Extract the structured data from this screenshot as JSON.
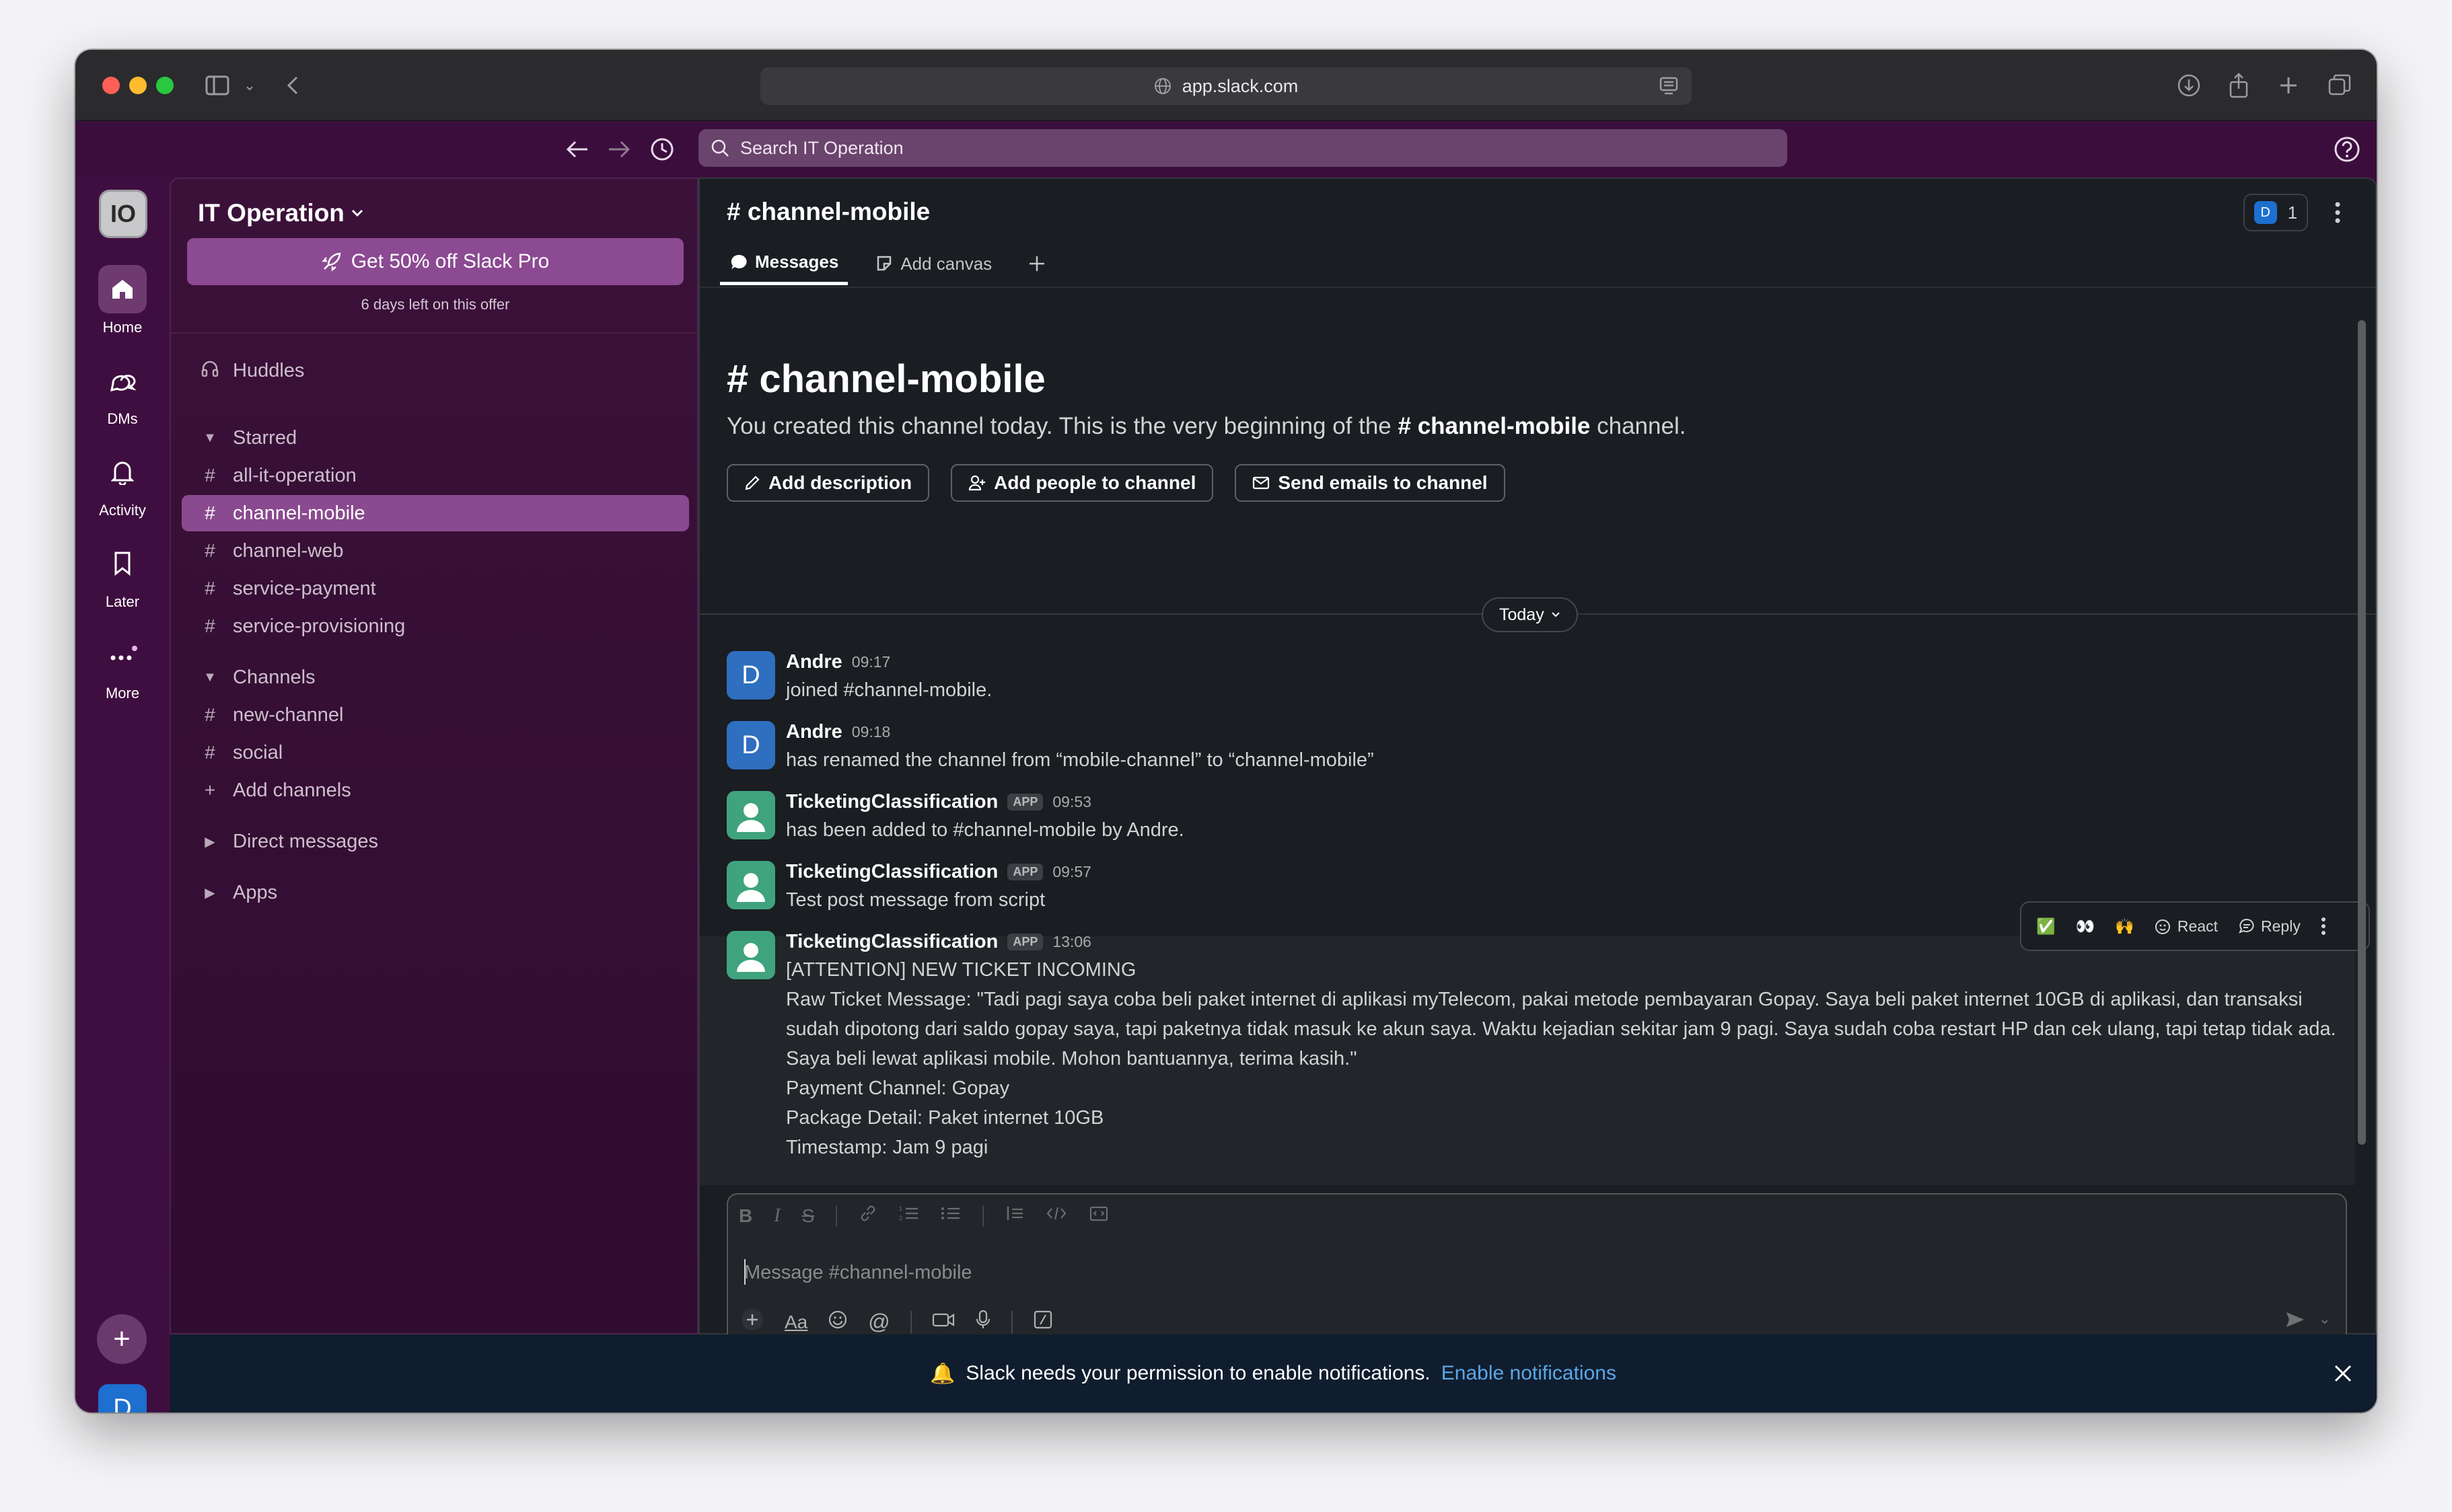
{
  "browser": {
    "url": "app.slack.com"
  },
  "topbar": {
    "search_placeholder": "Search IT Operation"
  },
  "rail": {
    "workspace_initials": "IO",
    "items": [
      {
        "label": "Home"
      },
      {
        "label": "DMs"
      },
      {
        "label": "Activity"
      },
      {
        "label": "Later"
      },
      {
        "label": "More"
      }
    ],
    "user_initial": "D"
  },
  "sidebar": {
    "workspace_name": "IT Operation",
    "promo_label": "Get 50% off Slack Pro",
    "promo_sub": "6 days left on this offer",
    "huddles": "Huddles",
    "starred_header": "Starred",
    "starred": [
      "all-it-operation",
      "channel-mobile",
      "channel-web",
      "service-payment",
      "service-provisioning"
    ],
    "channels_header": "Channels",
    "channels": [
      "new-channel",
      "social"
    ],
    "add_channels": "Add channels",
    "dm_header": "Direct messages",
    "apps_header": "Apps"
  },
  "channel": {
    "title": "# channel-mobile",
    "member_initial": "D",
    "member_count": "1",
    "tabs": [
      {
        "label": "Messages"
      },
      {
        "label": "Add canvas"
      }
    ],
    "intro_title": "# channel-mobile",
    "intro_pre": "You created this channel today. This is the very beginning of the ",
    "intro_channel": "# channel-mobile",
    "intro_post": " channel.",
    "buttons": [
      "Add description",
      "Add people to channel",
      "Send emails to channel"
    ],
    "day_divider": "Today"
  },
  "messages": [
    {
      "sender": "Andre",
      "time": "09:17",
      "avatar": "D",
      "app": false,
      "lines": [
        "joined #channel-mobile."
      ]
    },
    {
      "sender": "Andre",
      "time": "09:18",
      "avatar": "D",
      "app": false,
      "lines": [
        "has renamed the channel from “mobile-channel” to “channel-mobile”"
      ]
    },
    {
      "sender": "TicketingClassification",
      "time": "09:53",
      "app": true,
      "app_tag": "APP",
      "lines": [
        "has been added to #channel-mobile by Andre."
      ]
    },
    {
      "sender": "TicketingClassification",
      "time": "09:57",
      "app": true,
      "app_tag": "APP",
      "lines": [
        "Test post message from script"
      ]
    },
    {
      "sender": "TicketingClassification",
      "time": "13:06",
      "app": true,
      "app_tag": "APP",
      "lines": [
        "[ATTENTION] NEW TICKET INCOMING",
        "Raw Ticket Message: \"Tadi pagi saya coba beli paket internet di aplikasi myTelecom, pakai metode pembayaran Gopay. Saya beli paket internet 10GB di aplikasi, dan transaksi",
        "sudah dipotong dari saldo gopay saya, tapi paketnya tidak masuk ke akun saya. Waktu kejadian sekitar jam 9 pagi. Saya sudah coba restart HP dan cek ulang, tapi tetap tidak ada.",
        "Saya beli lewat aplikasi mobile. Mohon bantuannya, terima kasih.\"",
        "Payment Channel: Gopay",
        "Package Detail: Paket internet 10GB",
        "Timestamp: Jam 9 pagi"
      ]
    }
  ],
  "hover_actions": {
    "react": "React",
    "reply": "Reply",
    "emojis": [
      "✅",
      "👀",
      "🙌"
    ]
  },
  "composer": {
    "placeholder": "Message #channel-mobile",
    "format_label": "Aa"
  },
  "notification": {
    "text": "Slack needs your permission to enable notifications.",
    "link": "Enable notifications",
    "icon": "🔔"
  },
  "colors": {
    "aubergine": "#3f0e40",
    "selected": "#8a4a8f",
    "main_bg": "#1a1d21",
    "link": "#5aa7e8"
  }
}
